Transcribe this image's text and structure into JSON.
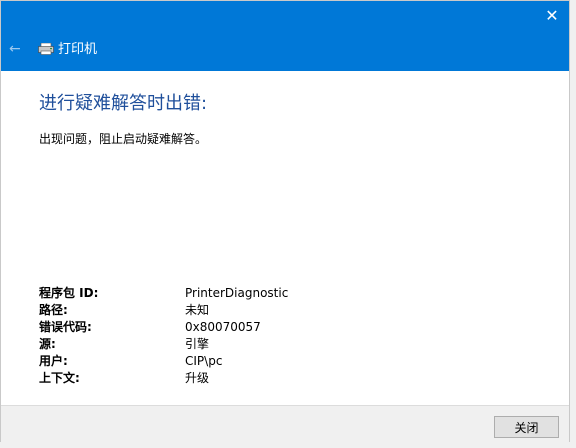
{
  "header": {
    "app_title": "打印机",
    "close_glyph": "✕",
    "back_glyph": "←",
    "background": "#0078d7"
  },
  "main": {
    "error_title": "进行疑难解答时出错:",
    "error_description": "出现问题，阻止启动疑难解答。"
  },
  "details": [
    {
      "label": "程序包 ID:",
      "value": "PrinterDiagnostic"
    },
    {
      "label": "路径:",
      "value": "未知"
    },
    {
      "label": "错误代码:",
      "value": "0x80070057"
    },
    {
      "label": "源:",
      "value": "引擎"
    },
    {
      "label": "用户:",
      "value": "CIP\\pc"
    },
    {
      "label": "上下文:",
      "value": "升级"
    }
  ],
  "footer": {
    "close_label": "关闭"
  },
  "icons": {
    "close": "close-icon",
    "back": "back-arrow-icon",
    "app": "printer-icon"
  }
}
